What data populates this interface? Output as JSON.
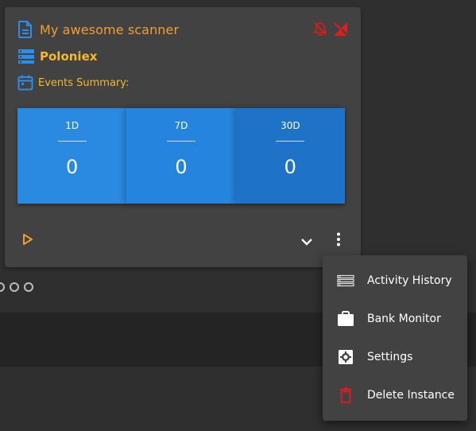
{
  "card": {
    "title": "My awesome scanner",
    "exchange": "Poloniex",
    "events_label": "Events Summary:",
    "summary": [
      {
        "period": "1D",
        "count": "0"
      },
      {
        "period": "7D",
        "count": "0"
      },
      {
        "period": "30D",
        "count": "0"
      }
    ]
  },
  "menu": {
    "items": [
      {
        "label": "Activity History",
        "icon": "list-icon"
      },
      {
        "label": "Bank Monitor",
        "icon": "briefcase-icon"
      },
      {
        "label": "Settings",
        "icon": "settings-icon"
      },
      {
        "label": "Delete Instance",
        "icon": "trash-icon"
      }
    ]
  },
  "colors": {
    "accent_orange": "#f29d2f",
    "accent_yellow": "#f5b82e",
    "icon_blue": "#2b8ee8",
    "alert_red": "#e21b1b",
    "card_bg": "#424242",
    "page_bg": "#2f2f2f"
  }
}
